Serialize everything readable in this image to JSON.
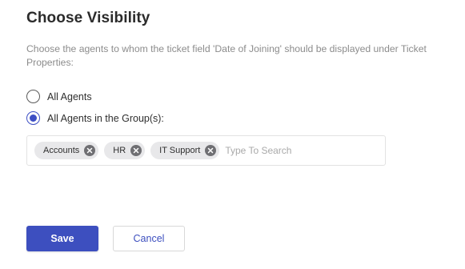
{
  "dialog": {
    "title": "Choose Visibility",
    "description": "Choose the agents to whom the ticket field 'Date of Joining' should be displayed under Ticket Properties:"
  },
  "visibility_options": [
    {
      "label": "All Agents",
      "selected": false
    },
    {
      "label": "All Agents in the Group(s):",
      "selected": true
    }
  ],
  "groups": {
    "selected": [
      {
        "label": "Accounts"
      },
      {
        "label": "HR"
      },
      {
        "label": "IT Support"
      }
    ],
    "search_placeholder": "Type To Search",
    "search_value": ""
  },
  "actions": {
    "save_label": "Save",
    "cancel_label": "Cancel"
  },
  "colors": {
    "accent": "#3d4fbf",
    "chip_bg": "#e8e8ea",
    "chip_remove_bg": "#6f6f73",
    "muted_text": "#8c8c8c"
  },
  "icons": {
    "chip_remove": "close-circle-icon",
    "radio_selected": "radio-checked-icon",
    "radio_unselected": "radio-unchecked-icon"
  }
}
